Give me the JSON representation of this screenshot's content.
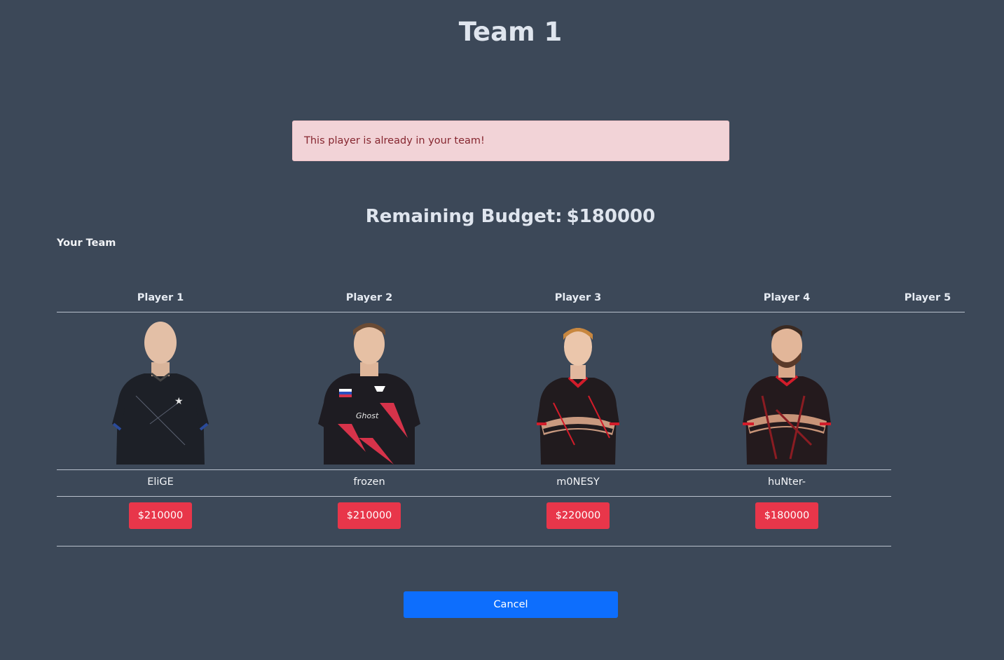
{
  "page": {
    "title": "Team 1",
    "alert": "This player is already in your team!",
    "budget_label": "Remaining Budget:",
    "budget_value": "$180000",
    "section_label": "Your Team"
  },
  "table": {
    "headers": [
      "Player 1",
      "Player 2",
      "Player 3",
      "Player 4",
      "Player 5"
    ],
    "players": [
      {
        "name": "EliGE",
        "price": "$210000",
        "jersey": "#1d2027",
        "accent": "#2a4a9a"
      },
      {
        "name": "frozen",
        "price": "$210000",
        "jersey": "#1e1c22",
        "accent": "#d6334a"
      },
      {
        "name": "m0NESY",
        "price": "$220000",
        "jersey": "#211b1e",
        "accent": "#d21c2a"
      },
      {
        "name": "huNter-",
        "price": "$180000",
        "jersey": "#241a1d",
        "accent": "#d21c2a"
      }
    ]
  },
  "actions": {
    "cancel_label": "Cancel"
  },
  "colors": {
    "background": "#3c4858",
    "alert_bg": "#f2d3d7",
    "price_button": "#e8364a",
    "cancel_button": "#0d6efd"
  }
}
